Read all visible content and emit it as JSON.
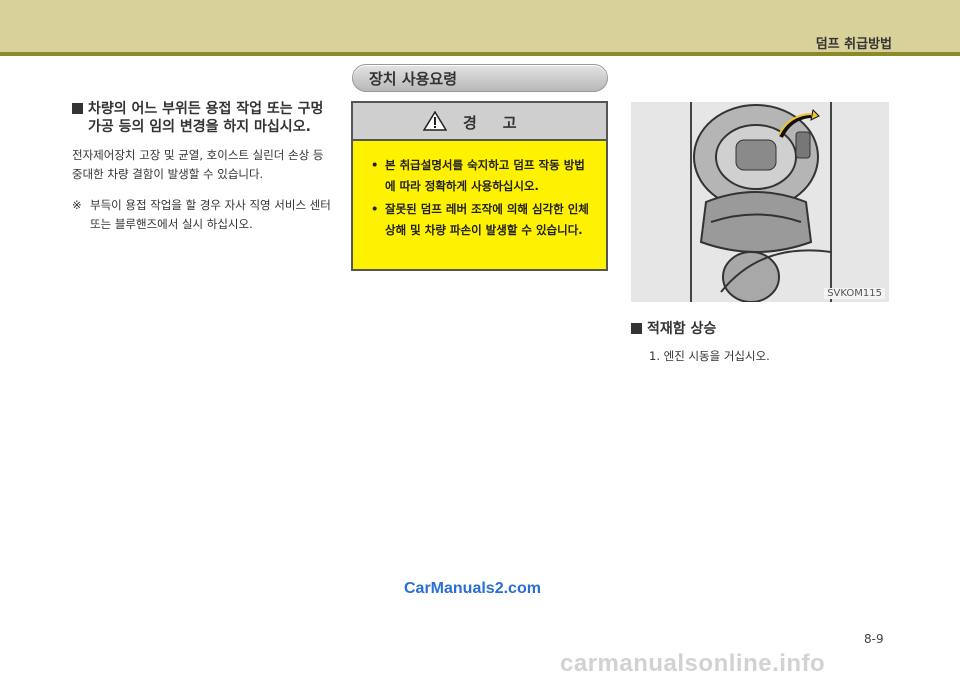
{
  "header": {
    "title": "덤프 취급방법"
  },
  "section_pill": {
    "label": "장치 사용요령"
  },
  "left": {
    "heading": "차량의 어느 부위든 용접 작업 또는 구멍 가공 등의 임의 변경을 하지 마십시오.",
    "body": "전자제어장치 고장 및 균열, 호이스트 실린더 손상 등 중대한 차량 결함이 발생할 수 있습니다.",
    "note_mark": "※",
    "note": "부득이 용접 작업을 할 경우 자사 직영 서비스 센터 또는 블루핸즈에서 실시 하십시오."
  },
  "warning": {
    "title": "경고",
    "items": [
      "본 취급설명서를 숙지하고 덤프 작동 방법에 따라 정확하게 사용하십시오.",
      "잘못된 덤프 레버 조작에 의해 심각한 인체 상해 및 차량 파손이 발생할 수 있습니다."
    ]
  },
  "figure": {
    "code": "SVKOM115"
  },
  "right": {
    "heading": "적재함 상승",
    "step": "1. 엔진 시동을 거십시오."
  },
  "footer": {
    "site_link": "CarManuals2.com",
    "page_number": "8-9",
    "watermark": "carmanualsonline.info"
  },
  "colors": {
    "header_band": "#d8d29a",
    "header_line": "#8a8a2a",
    "warning_bg": "#fff200",
    "link": "#2a6fd1"
  }
}
